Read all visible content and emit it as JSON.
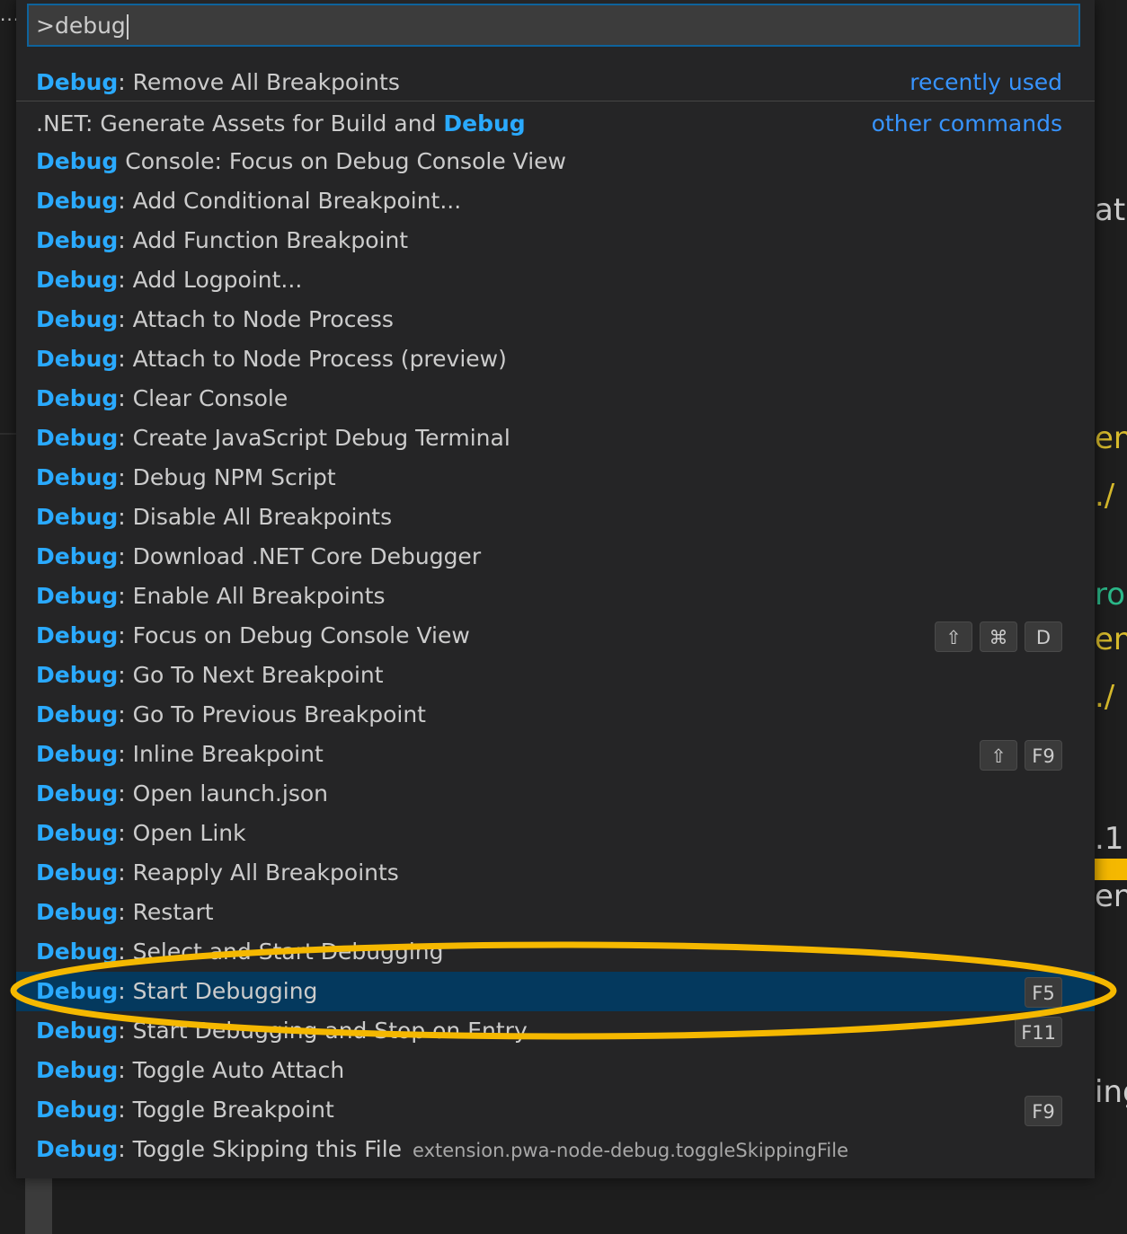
{
  "input": {
    "value": ">debug"
  },
  "background": {
    "dots": "···",
    "fragments": [
      {
        "text": "at y",
        "color": "#cccccc"
      },
      {
        "text": "en",
        "color": "#d7ba2c"
      },
      {
        "text": "./",
        "color": "#d7ba2c"
      },
      {
        "text": "ro",
        "color": "#2bb889"
      },
      {
        "text": "en",
        "color": "#d7ba2c"
      },
      {
        "text": "./",
        "color": "#d7ba2c"
      },
      {
        "text": ".1",
        "color": "#cccccc"
      },
      {
        "text": "en",
        "color": "#cccccc"
      },
      {
        "text": "ing",
        "color": "#cccccc"
      }
    ]
  },
  "commands": [
    {
      "prefix": "",
      "highlight": "Debug",
      "suffix": ": Remove All Breakpoints",
      "group": "recently used"
    },
    {
      "prefix": ".NET: Generate Assets for Build and ",
      "highlight": "Debug",
      "suffix": "",
      "group": "other commands"
    },
    {
      "prefix": "",
      "highlight": "Debug",
      "suffix": " Console: Focus on Debug Console View"
    },
    {
      "prefix": "",
      "highlight": "Debug",
      "suffix": ": Add Conditional Breakpoint..."
    },
    {
      "prefix": "",
      "highlight": "Debug",
      "suffix": ": Add Function Breakpoint"
    },
    {
      "prefix": "",
      "highlight": "Debug",
      "suffix": ": Add Logpoint..."
    },
    {
      "prefix": "",
      "highlight": "Debug",
      "suffix": ": Attach to Node Process"
    },
    {
      "prefix": "",
      "highlight": "Debug",
      "suffix": ": Attach to Node Process (preview)"
    },
    {
      "prefix": "",
      "highlight": "Debug",
      "suffix": ": Clear Console"
    },
    {
      "prefix": "",
      "highlight": "Debug",
      "suffix": ": Create JavaScript Debug Terminal"
    },
    {
      "prefix": "",
      "highlight": "Debug",
      "suffix": ": Debug NPM Script"
    },
    {
      "prefix": "",
      "highlight": "Debug",
      "suffix": ": Disable All Breakpoints"
    },
    {
      "prefix": "",
      "highlight": "Debug",
      "suffix": ": Download .NET Core Debugger"
    },
    {
      "prefix": "",
      "highlight": "Debug",
      "suffix": ": Enable All Breakpoints"
    },
    {
      "prefix": "",
      "highlight": "Debug",
      "suffix": ": Focus on Debug Console View",
      "keys": [
        "⇧",
        "⌘",
        "D"
      ]
    },
    {
      "prefix": "",
      "highlight": "Debug",
      "suffix": ": Go To Next Breakpoint"
    },
    {
      "prefix": "",
      "highlight": "Debug",
      "suffix": ": Go To Previous Breakpoint"
    },
    {
      "prefix": "",
      "highlight": "Debug",
      "suffix": ": Inline Breakpoint",
      "keys": [
        "⇧",
        "F9"
      ]
    },
    {
      "prefix": "",
      "highlight": "Debug",
      "suffix": ": Open launch.json"
    },
    {
      "prefix": "",
      "highlight": "Debug",
      "suffix": ": Open Link"
    },
    {
      "prefix": "",
      "highlight": "Debug",
      "suffix": ": Reapply All Breakpoints"
    },
    {
      "prefix": "",
      "highlight": "Debug",
      "suffix": ": Restart"
    },
    {
      "prefix": "",
      "highlight": "Debug",
      "suffix": ": Select and Start Debugging"
    },
    {
      "prefix": "",
      "highlight": "Debug",
      "suffix": ": Start Debugging",
      "keys": [
        "F5"
      ],
      "selected": true
    },
    {
      "prefix": "",
      "highlight": "Debug",
      "suffix": ": Start Debugging and Stop on Entry",
      "keys": [
        "F11"
      ]
    },
    {
      "prefix": "",
      "highlight": "Debug",
      "suffix": ": Toggle Auto Attach"
    },
    {
      "prefix": "",
      "highlight": "Debug",
      "suffix": ": Toggle Breakpoint",
      "keys": [
        "F9"
      ]
    },
    {
      "prefix": "",
      "highlight": "Debug",
      "suffix": ": Toggle Skipping this File",
      "detail": "extension.pwa-node-debug.toggleSkippingFile"
    }
  ],
  "annotation": {
    "shape": "ellipse",
    "color": "#f5b800",
    "target": "Debug: Start Debugging"
  }
}
